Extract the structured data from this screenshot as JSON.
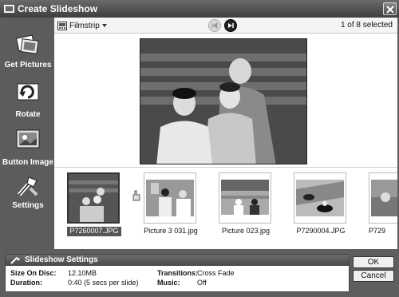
{
  "window": {
    "title": "Create Slideshow"
  },
  "sidebar": {
    "items": [
      {
        "label": "Get Pictures",
        "icon": "get-pictures-icon"
      },
      {
        "label": "Rotate",
        "icon": "rotate-icon"
      },
      {
        "label": "Button Image",
        "icon": "button-image-icon"
      },
      {
        "label": "Settings",
        "icon": "settings-icon"
      }
    ]
  },
  "toolbar": {
    "view_label": "Filmstrip",
    "selection_status": "1 of 8 selected"
  },
  "filmstrip": {
    "items": [
      {
        "caption": "P7260007.JPG"
      },
      {
        "caption": "Picture 3 031.jpg"
      },
      {
        "caption": "Picture 023.jpg"
      },
      {
        "caption": "P7290004.JPG"
      },
      {
        "caption": "P729"
      }
    ]
  },
  "settings": {
    "heading": "Slideshow Settings",
    "size_label": "Size On Disc:",
    "size_value": "12.10MB",
    "duration_label": "Duration:",
    "duration_value": "0:40 (5 secs per slide)",
    "transitions_label": "Transitions:",
    "transitions_value": "Cross Fade",
    "music_label": "Music:",
    "music_value": "Off"
  },
  "buttons": {
    "ok": "OK",
    "cancel": "Cancel"
  }
}
